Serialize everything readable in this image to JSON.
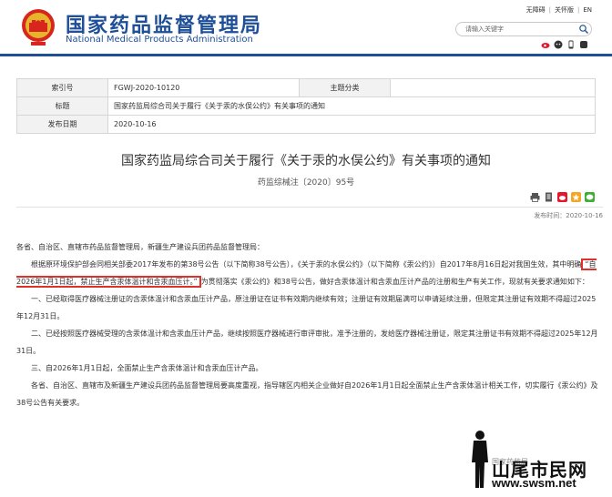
{
  "header": {
    "title_cn": "国家药品监督管理局",
    "title_en": "National Medical Products Administration",
    "links": [
      "无障碍",
      "关怀版",
      "EN"
    ],
    "search_placeholder": "请输入关键字"
  },
  "meta": {
    "index_label": "索引号",
    "index_value": "FGWJ-2020-10120",
    "category_label": "主题分类",
    "category_value": "",
    "title_label": "标题",
    "title_value": "国家药监局综合司关于履行《关于汞的水俣公约》有关事项的通知",
    "date_label": "发布日期",
    "date_value": "2020-10-16"
  },
  "article": {
    "title": "国家药监局综合司关于履行《关于汞的水俣公约》有关事项的通知",
    "doc_no": "药监综械注〔2020〕95号",
    "publish_time": "发布时间：2020-10-16",
    "salutation": "各省、自治区、直辖市药品监督管理局，新疆生产建设兵团药品监督管理局：",
    "p1_a": "根据原环境保护部会同相关部委2017年发布的第38号公告（以下简称38号公告），《关于汞的水俣公约》（以下简称《汞公约》）自2017年8月16日起对我国生效，其中明确",
    "p1_hl": "“自2026年1月1日起，禁止生产含汞体温计和含汞血压计。”",
    "p1_b": "为贯彻落实《汞公约》和38号公告，做好含汞体温计和含汞血压计产品的注册和生产有关工作，现就有关要求通知如下：",
    "p2": "一、已经取得医疗器械注册证的含汞体温计和含汞血压计产品，原注册证在证书有效期内继续有效；注册证有效期届满可以申请延续注册，但限定其注册证有效期不得超过2025年12月31日。",
    "p3": "二、已经按照医疗器械受理的含汞体温计和含汞血压计产品，继续按照医疗器械进行审评审批，准予注册的，发给医疗器械注册证，限定其注册证书有效期不得超过2025年12月31日。",
    "p4": "三、自2026年1月1日起，全面禁止生产含汞体温计和含汞血压计产品。",
    "p5": "各省、自治区、直辖市及新疆生产建设兵团药品监督管理局要高度重视，指导辖区内相关企业做好自2026年1月1日起全面禁止生产含汞体温计相关工作，切实履行《汞公约》及38号公告有关要求。"
  },
  "watermark": {
    "brand": "山尾市民网",
    "url": "www.swsm.net",
    "faint": "国家药监局"
  },
  "colors": {
    "brand_blue": "#1e4f97",
    "highlight_red": "#e0302a"
  }
}
